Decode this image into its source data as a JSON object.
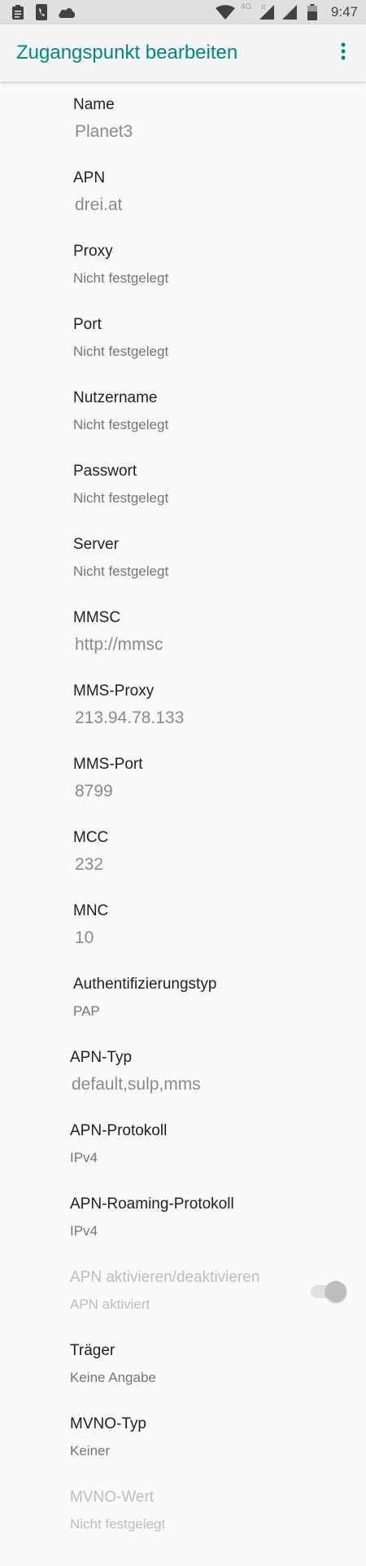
{
  "status_bar": {
    "time": "9:47",
    "network_label": "4G",
    "roaming_label": "R",
    "icons": [
      "clipboard-icon",
      "phone-icon",
      "cloud-icon",
      "wifi-icon",
      "signal-icon",
      "signal-icon",
      "battery-icon"
    ]
  },
  "app_bar": {
    "title": "Zugangspunkt bearbeiten",
    "menu_icon": "more-vert-icon"
  },
  "colors": {
    "accent": "#00897b",
    "status_bar_bg": "#e0e0e0",
    "background": "#fafafa"
  },
  "preferences": [
    {
      "key": "name",
      "title": "Name",
      "summary": "Planet3",
      "style": "edit"
    },
    {
      "key": "apn",
      "title": "APN",
      "summary": "drei.at",
      "style": "edit"
    },
    {
      "key": "proxy",
      "title": "Proxy",
      "summary": "Nicht festgelegt",
      "style": "text"
    },
    {
      "key": "port",
      "title": "Port",
      "summary": "Nicht festgelegt",
      "style": "text"
    },
    {
      "key": "username",
      "title": "Nutzername",
      "summary": "Nicht festgelegt",
      "style": "text"
    },
    {
      "key": "password",
      "title": "Passwort",
      "summary": "Nicht festgelegt",
      "style": "text"
    },
    {
      "key": "server",
      "title": "Server",
      "summary": "Nicht festgelegt",
      "style": "text"
    },
    {
      "key": "mmsc",
      "title": "MMSC",
      "summary": "http://mmsc",
      "style": "edit"
    },
    {
      "key": "mms-proxy",
      "title": "MMS-Proxy",
      "summary": "213.94.78.133",
      "style": "edit"
    },
    {
      "key": "mms-port",
      "title": "MMS-Port",
      "summary": "8799",
      "style": "edit"
    },
    {
      "key": "mcc",
      "title": "MCC",
      "summary": "232",
      "style": "edit"
    },
    {
      "key": "mnc",
      "title": "MNC",
      "summary": "10",
      "style": "edit"
    },
    {
      "key": "auth-type",
      "title": "Authentifizierungstyp",
      "summary": "PAP",
      "style": "text"
    },
    {
      "key": "apn-type",
      "title": "APN-Typ",
      "summary": "default,sulp,mms",
      "style": "edit"
    },
    {
      "key": "apn-protocol",
      "title": "APN-Protokoll",
      "summary": "IPv4",
      "style": "text"
    },
    {
      "key": "apn-roaming-protocol",
      "title": "APN-Roaming-Protokoll",
      "summary": "IPv4",
      "style": "text"
    },
    {
      "key": "apn-enable",
      "title": "APN aktivieren/deaktivieren",
      "summary": "APN aktiviert",
      "style": "switch",
      "enabled": false,
      "checked": true
    },
    {
      "key": "bearer",
      "title": "Träger",
      "summary": "Keine Angabe",
      "style": "text"
    },
    {
      "key": "mvno-type",
      "title": "MVNO-Typ",
      "summary": "Keiner",
      "style": "text"
    },
    {
      "key": "mvno-value",
      "title": "MVNO-Wert",
      "summary": "Nicht festgelegt",
      "style": "text",
      "enabled": false
    }
  ]
}
